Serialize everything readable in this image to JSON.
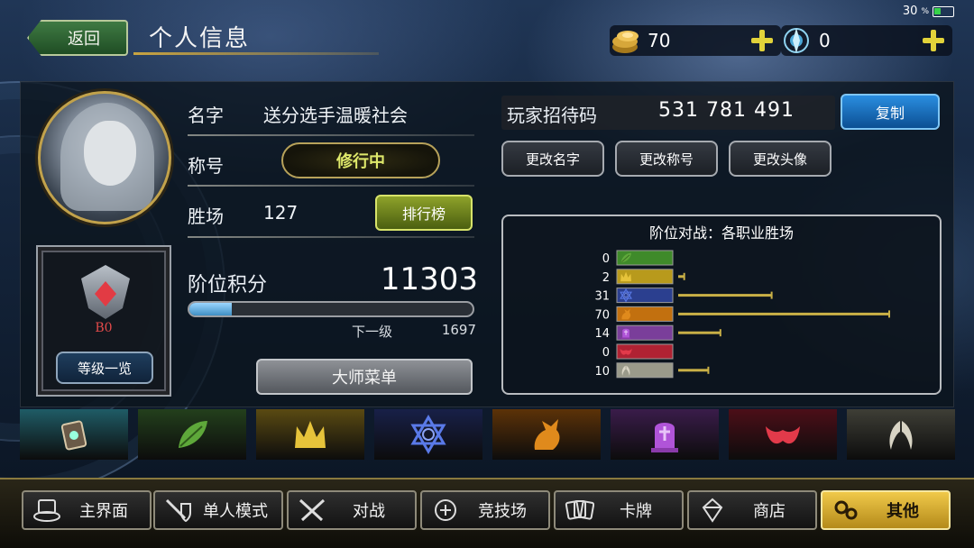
{
  "status_bar": {
    "battery_percent": "30",
    "battery_unit": "%"
  },
  "header": {
    "back_label": "返回",
    "title": "个人信息"
  },
  "currencies": [
    {
      "icon": "gold-coin-icon",
      "value": "70"
    },
    {
      "icon": "crystal-orb-icon",
      "value": "0"
    }
  ],
  "profile": {
    "name_label": "名字",
    "name_value": "送分选手温暖社会",
    "title_label": "称号",
    "title_value": "修行中",
    "wins_label": "胜场",
    "wins_value": "127",
    "leaderboard_label": "排行榜",
    "rank_label": "B0",
    "rank_list_label": "等级一览",
    "score_label": "阶位积分",
    "score_value": "11303",
    "next_label": "下一级",
    "next_value": "1697",
    "progress_fraction": 0.15,
    "master_menu_label": "大师菜单"
  },
  "invite": {
    "label": "玩家招待码",
    "code": "531 781 491",
    "copy_label": "复制"
  },
  "actions": [
    "更改名字",
    "更改称号",
    "更改头像"
  ],
  "chart_data": {
    "type": "bar",
    "title": "阶位对战：各职业胜场",
    "orientation": "horizontal",
    "categories": [
      "elf",
      "royal",
      "witch",
      "dragon",
      "necromancer",
      "vampire",
      "bishop"
    ],
    "values": [
      0,
      2,
      31,
      70,
      14,
      0,
      10
    ],
    "colors": [
      "#3f8a2a",
      "#b89a1c",
      "#2b3f8f",
      "#c2700f",
      "#7a3e9a",
      "#b02233",
      "#9a9a8a"
    ],
    "bar_color": "#c9b046",
    "xlim": [
      0,
      70
    ]
  },
  "class_tabs": [
    {
      "icon": "portal-icon",
      "color": "#1f5c66"
    },
    {
      "icon": "leaf-icon",
      "color": "#233f1c"
    },
    {
      "icon": "crown-icon",
      "color": "#5a4a12"
    },
    {
      "icon": "hexagram-icon",
      "color": "#182048"
    },
    {
      "icon": "dragon-icon",
      "color": "#5c3208"
    },
    {
      "icon": "tombstone-icon",
      "color": "#3a1c4a"
    },
    {
      "icon": "bat-wing-icon",
      "color": "#4c0e18"
    },
    {
      "icon": "angel-wing-icon",
      "color": "#3e3e36"
    }
  ],
  "nav": [
    {
      "label": "主界面",
      "icon": "home-icon",
      "active": false
    },
    {
      "label": "单人模式",
      "icon": "sword-shield-icon",
      "active": false
    },
    {
      "label": "对战",
      "icon": "crossed-swords-icon",
      "active": false
    },
    {
      "label": "竞技场",
      "icon": "arena-icon",
      "active": false
    },
    {
      "label": "卡牌",
      "icon": "cards-icon",
      "active": false
    },
    {
      "label": "商店",
      "icon": "shop-gem-icon",
      "active": false
    },
    {
      "label": "其他",
      "icon": "gears-icon",
      "active": true
    }
  ]
}
